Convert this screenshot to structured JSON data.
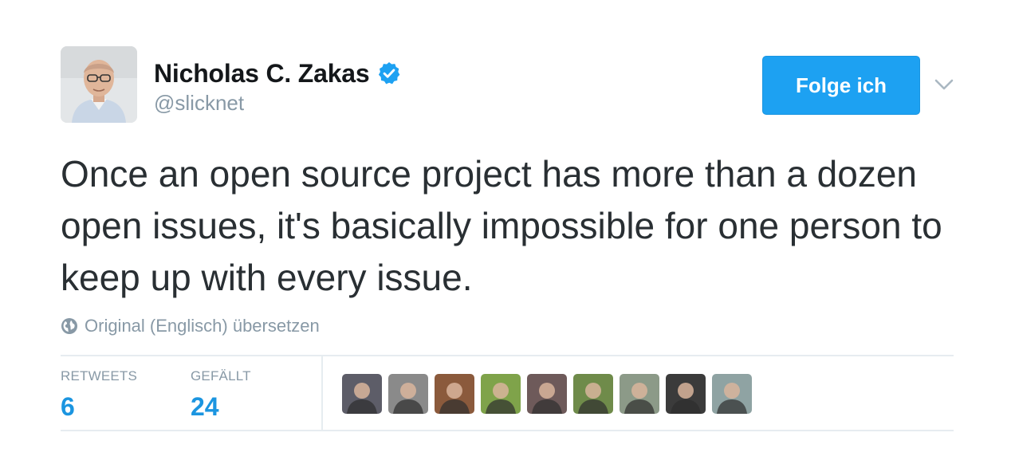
{
  "author": {
    "name": "Nicholas C. Zakas",
    "handle": "@slicknet",
    "verified": true,
    "avatar_icon": "profile-photo"
  },
  "follow_button": {
    "label": "Folge ich"
  },
  "more_menu_icon": "chevron-down-icon",
  "tweet": {
    "text": "Once an open source project has more than a dozen open issues, it's basically impossible for one person to keep up with every issue."
  },
  "translate": {
    "icon": "globe-icon",
    "label": "Original (Englisch) übersetzen"
  },
  "stats": {
    "retweets": {
      "label": "RETWEETS",
      "count": "6"
    },
    "likes": {
      "label": "GEFÄLLT",
      "count": "24"
    }
  },
  "likers": [
    {
      "icon": "liker-avatar",
      "color": "#5d5d68"
    },
    {
      "icon": "liker-avatar",
      "color": "#8a8a8a"
    },
    {
      "icon": "liker-avatar",
      "color": "#8b5a3c"
    },
    {
      "icon": "liker-avatar",
      "color": "#7fa34a"
    },
    {
      "icon": "liker-avatar",
      "color": "#6e5a5a"
    },
    {
      "icon": "liker-avatar",
      "color": "#6f8b4a"
    },
    {
      "icon": "liker-avatar",
      "color": "#8c9a88"
    },
    {
      "icon": "liker-avatar",
      "color": "#3b3b3b"
    },
    {
      "icon": "liker-avatar",
      "color": "#8fa3a3"
    }
  ],
  "colors": {
    "accent": "#1da1f2",
    "count_blue": "#1b95e0",
    "muted": "#8899a6",
    "text": "#292f33"
  }
}
